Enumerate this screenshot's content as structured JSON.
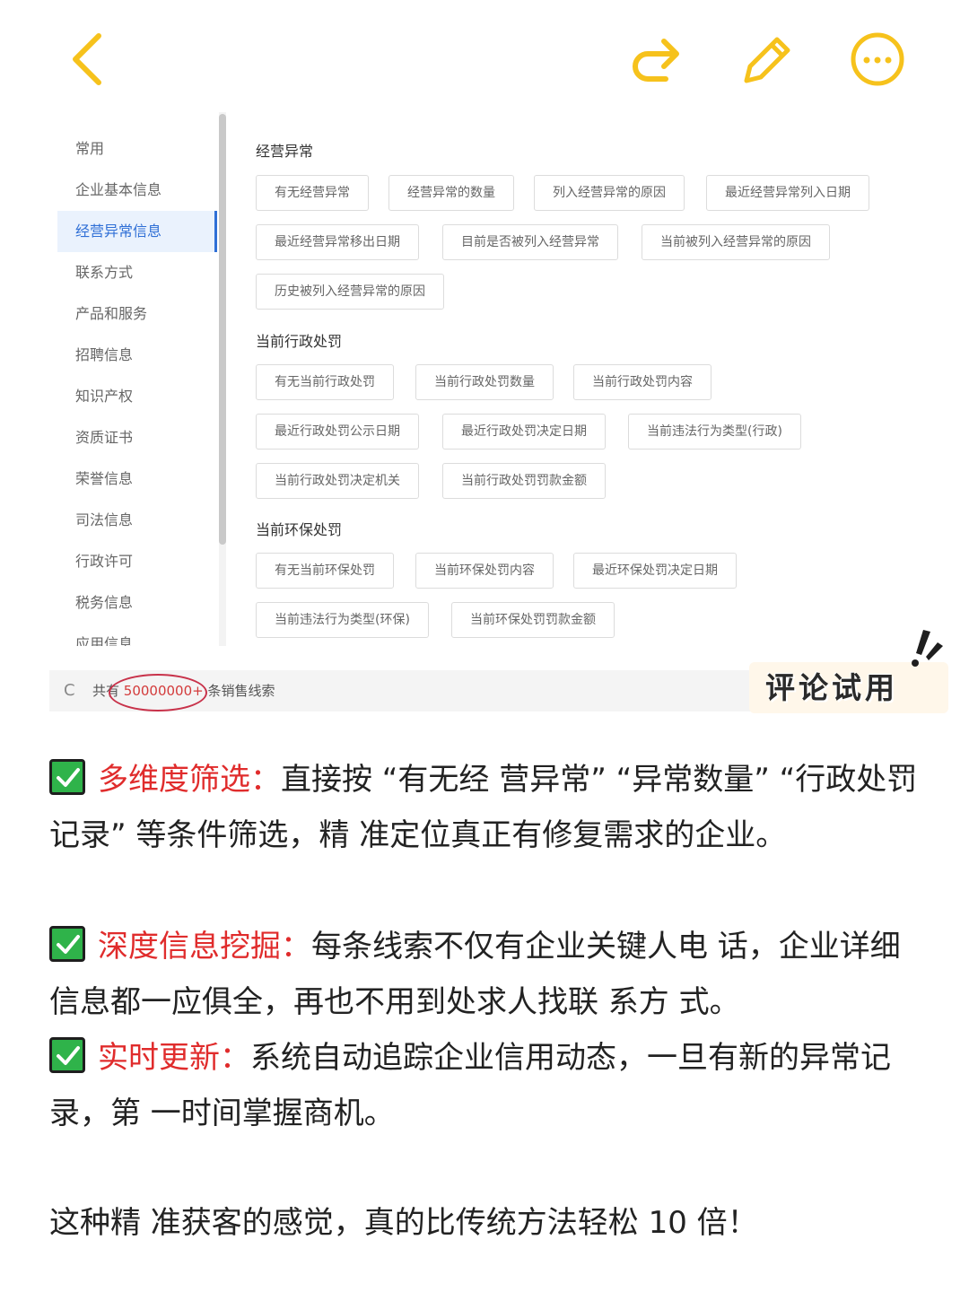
{
  "topbar": {
    "back_icon": "chevron-left-icon",
    "share_icon": "share-redo-icon",
    "edit_icon": "pencil-icon",
    "more_icon": "more-dots-icon",
    "accent": "#f6c21c"
  },
  "sidebar": {
    "items": [
      {
        "label": "常用"
      },
      {
        "label": "企业基本信息"
      },
      {
        "label": "经营异常信息",
        "active": true
      },
      {
        "label": "联系方式"
      },
      {
        "label": "产品和服务"
      },
      {
        "label": "招聘信息"
      },
      {
        "label": "知识产权"
      },
      {
        "label": "资质证书"
      },
      {
        "label": "荣誉信息"
      },
      {
        "label": "司法信息"
      },
      {
        "label": "行政许可"
      },
      {
        "label": "税务信息"
      },
      {
        "label": "应用信息"
      }
    ]
  },
  "sections": [
    {
      "title": "经营异常",
      "tags": [
        "有无经营异常",
        "经营异常的数量",
        "列入经营异常的原因",
        "最近经营异常列入日期",
        "最近经营异常移出日期",
        "目前是否被列入经营异常",
        "当前被列入经营异常的原因",
        "历史被列入经营异常的原因"
      ]
    },
    {
      "title": "当前行政处罚",
      "tags": [
        "有无当前行政处罚",
        "当前行政处罚数量",
        "当前行政处罚内容",
        "最近行政处罚公示日期",
        "最近行政处罚决定日期",
        "当前违法行为类型(行政)",
        "当前行政处罚决定机关",
        "当前行政处罚罚款金额"
      ]
    },
    {
      "title": "当前环保处罚",
      "tags": [
        "有无当前环保处罚",
        "当前环保处罚内容",
        "最近环保处罚决定日期",
        "当前违法行为类型(环保)",
        "当前环保处罚罚款金额"
      ]
    }
  ],
  "footer": {
    "refresh_icon": "refresh-icon",
    "prefix": "共有",
    "count": "50000000+",
    "suffix": "条销售线索"
  },
  "badge": {
    "label": "评论试用"
  },
  "paragraphs": [
    {
      "highlight": "多维度筛选：",
      "text": "直接按 “有无经 营异常” “异常数量” “行政处罚记录” 等条件筛选，精 准定位真正有修复需求的企业。"
    },
    {
      "highlight": "深度信息挖掘：",
      "text": "每条线索不仅有企业关键人电 话，企业详细信息都一应俱全，再也不用到处求人找联 系方 式。"
    },
    {
      "highlight": "实时更新：",
      "text": "系统自动追踪企业信用动态，一旦有新的异常记录，第 一时间掌握商机。"
    }
  ],
  "closing": "这种精 准获客的感觉，真的比传统方法轻松 10 倍！"
}
